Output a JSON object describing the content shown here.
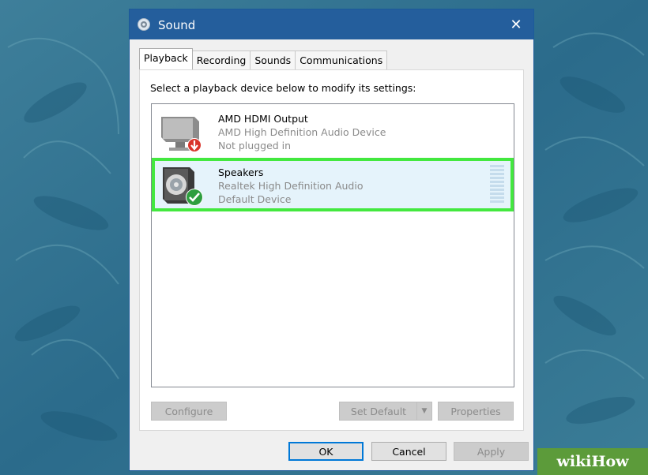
{
  "window": {
    "title": "Sound",
    "close_glyph": "✕"
  },
  "tabs": [
    {
      "label": "Playback",
      "active": true
    },
    {
      "label": "Recording",
      "active": false
    },
    {
      "label": "Sounds",
      "active": false
    },
    {
      "label": "Communications",
      "active": false
    }
  ],
  "playback": {
    "instruction": "Select a playback device below to modify its settings:",
    "devices": [
      {
        "name": "AMD HDMI Output",
        "description": "AMD High Definition Audio Device",
        "status": "Not plugged in",
        "icon": "monitor-icon",
        "badge": "red-down-arrow",
        "selected": false
      },
      {
        "name": "Speakers",
        "description": "Realtek High Definition Audio",
        "status": "Default Device",
        "icon": "speaker-icon",
        "badge": "green-check",
        "selected": true
      }
    ]
  },
  "buttons": {
    "configure": "Configure",
    "set_default": "Set Default",
    "properties": "Properties",
    "ok": "OK",
    "cancel": "Cancel",
    "apply": "Apply"
  },
  "watermark": {
    "text": "wikiHow"
  },
  "colors": {
    "titlebar": "#245e9c",
    "highlight": "#43e83f",
    "selected_bg": "#e5f3fb"
  }
}
